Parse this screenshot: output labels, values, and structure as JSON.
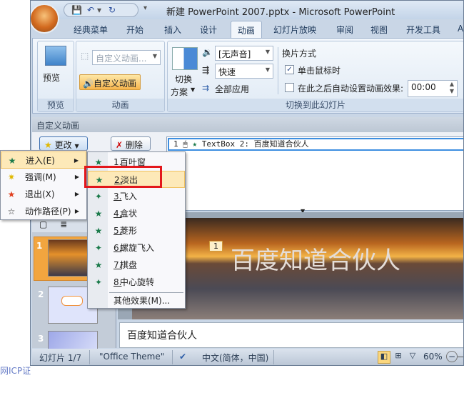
{
  "window": {
    "title": "新建 PowerPoint 2007.pptx - Microsoft PowerPoint"
  },
  "qat": {
    "save": "💾",
    "undo": "↶",
    "undo_dd": "▾",
    "redo": "↻",
    "customize": "▾"
  },
  "tabs": [
    "经典菜单",
    "开始",
    "插入",
    "设计",
    "动画",
    "幻灯片放映",
    "审阅",
    "视图",
    "开发工具",
    "A"
  ],
  "ribbon": {
    "preview": {
      "button": "预览",
      "group": "预览"
    },
    "animation": {
      "custom_dropdown": "自定义动画...",
      "custom_button": "自定义动画",
      "group": "动画"
    },
    "transition": {
      "scheme_line1": "切换",
      "scheme_line2": "方案",
      "sound": "[无声音]",
      "speed": "快速",
      "apply_all": "全部应用",
      "group": "切换到此幻灯片"
    },
    "advance": {
      "title": "换片方式",
      "on_click": "单击鼠标时",
      "on_click_checked": true,
      "auto_after": "在此之后自动设置动画效果:",
      "auto_after_checked": false,
      "time": "00:00"
    }
  },
  "taskpane": {
    "title": "自定义动画",
    "change": "更改",
    "delete": "删除",
    "item": {
      "index": "1",
      "text": "TextBox 2: 百度知道合伙人"
    }
  },
  "menu1": [
    {
      "label": "进入(E)",
      "key": "E",
      "icon": "entrance-star"
    },
    {
      "label": "强调(M)",
      "key": "M",
      "icon": "emphasis-star"
    },
    {
      "label": "退出(X)",
      "key": "X",
      "icon": "exit-star"
    },
    {
      "label": "动作路径(P)",
      "key": "P",
      "icon": "motion-path-star"
    }
  ],
  "menu2": [
    {
      "num": "1",
      "label": "百叶窗"
    },
    {
      "num": "2",
      "label": "淡出"
    },
    {
      "num": "3",
      "label": "飞入"
    },
    {
      "num": "4",
      "label": "盒状"
    },
    {
      "num": "5",
      "label": "菱形"
    },
    {
      "num": "6",
      "label": "螺旋飞入"
    },
    {
      "num": "7",
      "label": "棋盘"
    },
    {
      "num": "8",
      "label": "中心旋转"
    }
  ],
  "menu2_more": "其他效果(M)...",
  "slides": {
    "numbers": [
      "1",
      "2",
      "3"
    ]
  },
  "slide": {
    "tag": "1",
    "title": "百度知道合伙人"
  },
  "notes": "百度知道合伙人",
  "status": {
    "slide": "幻灯片 1/7",
    "theme": "\"Office Theme\"",
    "language": "中文(简体，中国)",
    "zoom": "60%"
  },
  "background_text": "网ICP证"
}
